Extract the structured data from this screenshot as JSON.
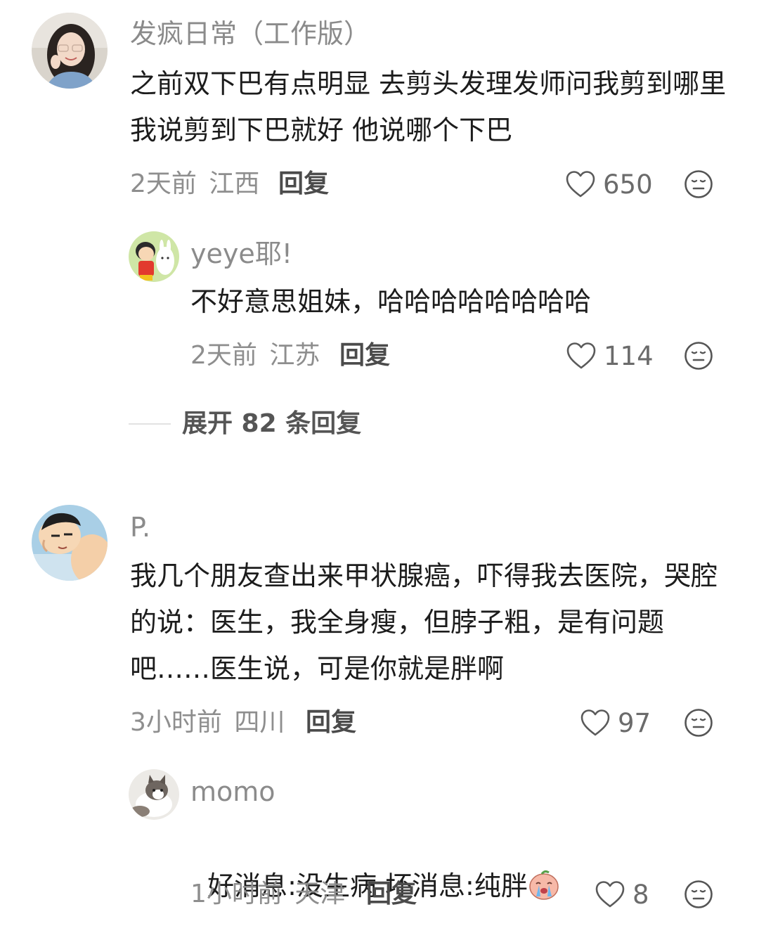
{
  "comments": [
    {
      "username": "发疯日常（工作版）",
      "text": "之前双下巴有点明显 去剪头发理发师问我剪到哪里 我说剪到下巴就好 他说哪个下巴",
      "time": "2天前",
      "location": "江西",
      "reply_label": "回复",
      "likes": "650",
      "replies": [
        {
          "username": "yeye耶!",
          "text": "不好意思姐妹，哈哈哈哈哈哈哈哈",
          "time": "2天前",
          "location": "江苏",
          "reply_label": "回复",
          "likes": "114"
        }
      ],
      "expand_label": "展开 82 条回复"
    },
    {
      "username": "P.",
      "text": "我几个朋友查出来甲状腺癌，吓得我去医院，哭腔的说：医生，我全身瘦，但脖子粗，是有问题吧……医生说，可是你就是胖啊",
      "time": "3小时前",
      "location": "四川",
      "reply_label": "回复",
      "likes": "97",
      "replies": [
        {
          "username": "momo",
          "text": "好消息:没生病 坏消息:纯胖",
          "emoji": "crying-face-emoji",
          "time": "1小时前",
          "location": "天津",
          "reply_label": "回复",
          "likes": "8"
        }
      ]
    }
  ]
}
